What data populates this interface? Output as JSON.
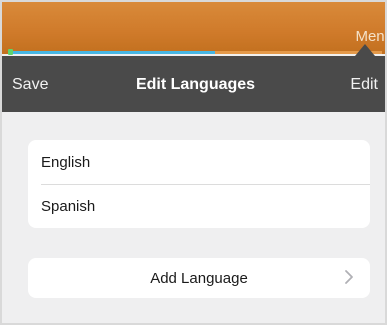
{
  "topbar": {
    "menu_label": "Menu",
    "progress_fraction": 0.55
  },
  "navbar": {
    "save_label": "Save",
    "title": "Edit Languages",
    "edit_label": "Edit"
  },
  "languages": [
    {
      "label": "English"
    },
    {
      "label": "Spanish"
    }
  ],
  "add_language": {
    "label": "Add Language",
    "icon": "chevron-right-icon"
  },
  "colors": {
    "topbar": "#cf7a2a",
    "navbar": "#4a4a4a",
    "progress": "#47b6e3",
    "background": "#efeff0"
  }
}
